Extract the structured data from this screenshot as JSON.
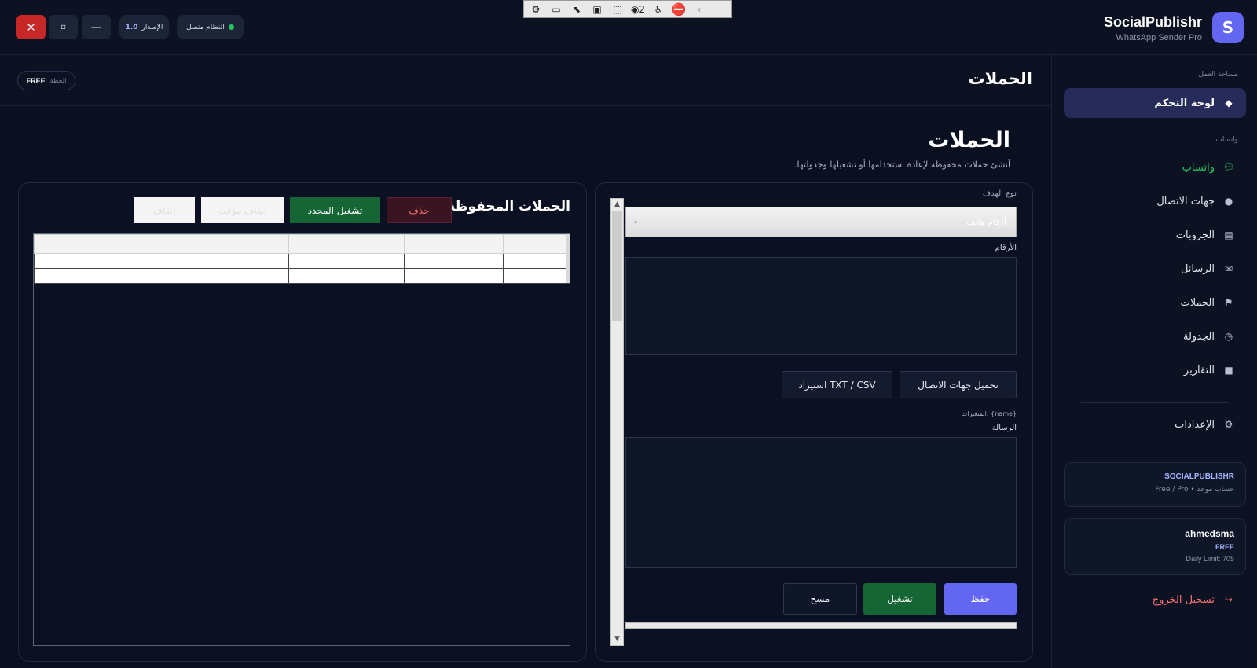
{
  "window": {
    "close_glyph": "✕",
    "maximize_glyph": "▫",
    "minimize_glyph": "—",
    "version_label": "الإصدار",
    "version_value": "1.0",
    "status_text": "النظام متصل",
    "status_color": "#22c55e"
  },
  "toolstrip": {
    "badge_count": "2",
    "icons": [
      "settings-icon",
      "record-icon",
      "pointer-icon",
      "frame-icon",
      "select-icon",
      "record-badge-icon",
      "accessibility-icon",
      "stop-icon",
      "collapse-icon"
    ]
  },
  "brand": {
    "logo_letter": "S",
    "name": "SocialPublishr",
    "subtitle": "WhatsApp Sender Pro",
    "accent": "#6366f1"
  },
  "sidebar": {
    "section_workspace": "مساحة العمل",
    "dashboard": "لوحة التحكم",
    "section_whatsapp": "واتساب",
    "items": [
      {
        "label": "واتساب",
        "icon": "chat-bubble-icon"
      },
      {
        "label": "جهات الاتصال",
        "icon": "contact-icon"
      },
      {
        "label": "الجروبات",
        "icon": "group-icon"
      },
      {
        "label": "الرسائل",
        "icon": "envelope-icon"
      },
      {
        "label": "الحملات",
        "icon": "flag-icon"
      },
      {
        "label": "الجدولة",
        "icon": "clock-icon"
      },
      {
        "label": "التقارير",
        "icon": "report-icon"
      }
    ],
    "settings": "الإعدادات",
    "account_card": {
      "title": "SOCIALPUBLISHR",
      "subtitle": "حساب موحد • Free / Pro"
    },
    "user_card": {
      "username": "ahmedsma",
      "plan": "FREE",
      "limit": "Daily Limit: 705"
    },
    "logout": "تسجيل الخروج"
  },
  "header": {
    "title": "الحملات",
    "plan_label": "الخطة",
    "plan_value": "FREE"
  },
  "page": {
    "title": "الحملات",
    "subtitle": "أنشئ حملات محفوظة لإعادة استخدامها أو تشغيلها وجدولتها."
  },
  "form": {
    "target_type_label": "نوع الهدف",
    "target_type_value": "أرقام هاتف",
    "numbers_label": "الأرقام",
    "load_contacts_button": "تحميل جهات الاتصال",
    "import_button": "استيراد TXT / CSV",
    "variables_hint": "المتغيرات: {name}",
    "message_label": "الرسالة",
    "save_button": "حفظ",
    "run_button": "تشغيل",
    "clear_button": "مسح"
  },
  "saved": {
    "title": "الحملات المحفوظة",
    "delete_button": "حذف",
    "run_selected_button": "تشغيل المحدد",
    "pause_button": "إيقاف مؤقت",
    "stop_button": "إيقاف"
  }
}
